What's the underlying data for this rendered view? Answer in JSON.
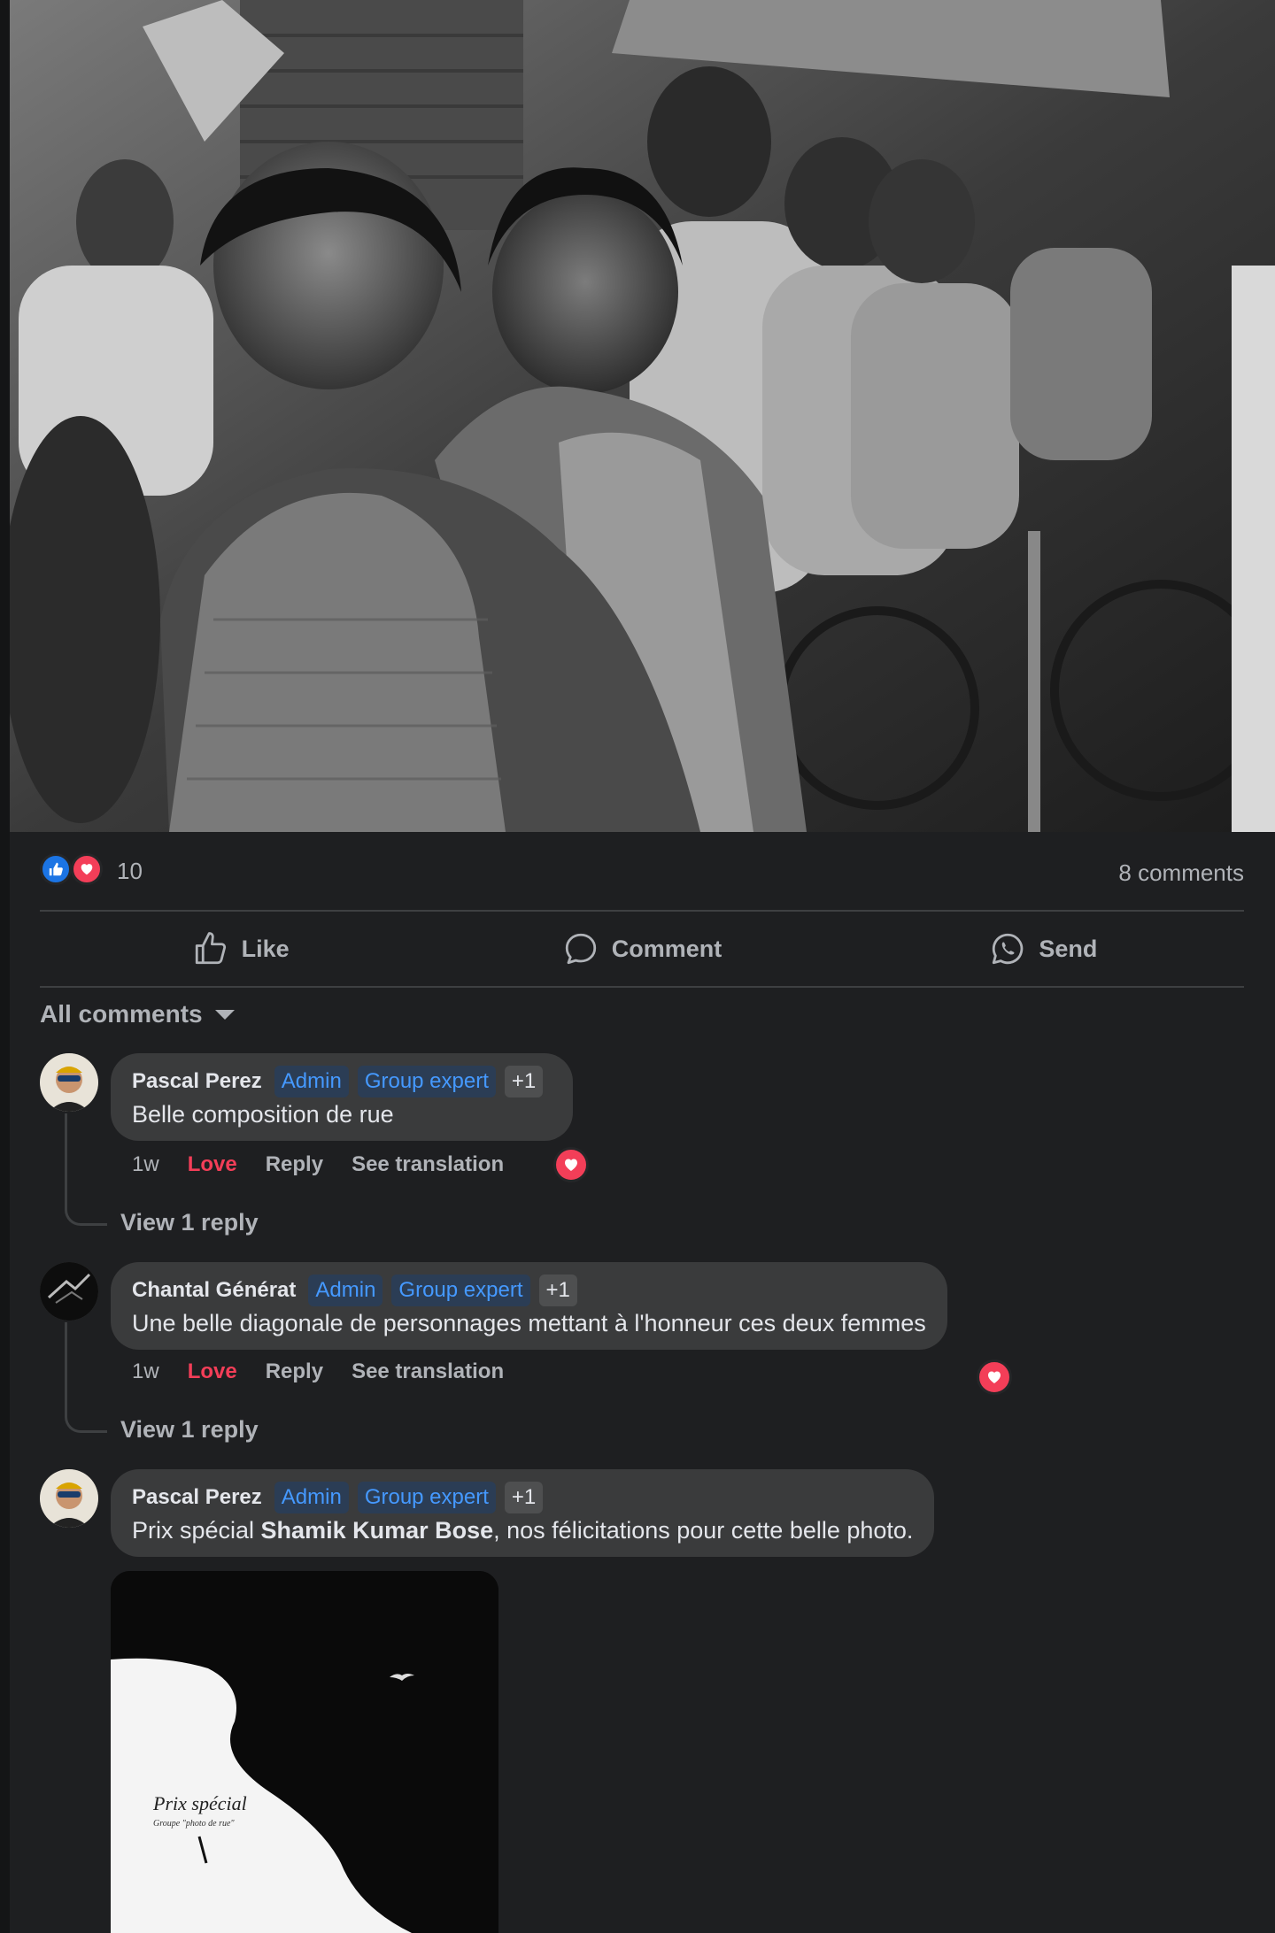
{
  "reactions": {
    "icons": [
      "like-icon",
      "love-icon"
    ],
    "count": "10",
    "comments_count": "8 comments"
  },
  "actions": {
    "like": "Like",
    "comment": "Comment",
    "send": "Send"
  },
  "filter": {
    "label": "All comments"
  },
  "comments": [
    {
      "author": "Pascal Perez",
      "badges": [
        "Admin",
        "Group expert",
        "+1"
      ],
      "text": "Belle composition de rue",
      "time": "1w",
      "reaction_label": "Love",
      "reply_label": "Reply",
      "translate_label": "See translation",
      "view_replies": "View 1 reply"
    },
    {
      "author": "Chantal Générat",
      "badges": [
        "Admin",
        "Group expert",
        "+1"
      ],
      "text": "Une belle diagonale de personnages mettant à l'honneur ces deux femmes",
      "time": "1w",
      "reaction_label": "Love",
      "reply_label": "Reply",
      "translate_label": "See translation",
      "view_replies": "View 1 reply"
    },
    {
      "author": "Pascal Perez",
      "badges": [
        "Admin",
        "Group expert",
        "+1"
      ],
      "text_before": "Prix spécial ",
      "text_mention": "Shamik Kumar Bose",
      "text_after": ", nos félicitations pour cette belle photo."
    }
  ],
  "attachment": {
    "title": "Prix spécial",
    "subtitle": "Groupe \"photo de rue\""
  },
  "colors": {
    "background": "#1e1f21",
    "bubble": "#3a3b3c",
    "badge_text": "#4599ff",
    "love": "#f33e58",
    "like": "#1b74e4"
  }
}
